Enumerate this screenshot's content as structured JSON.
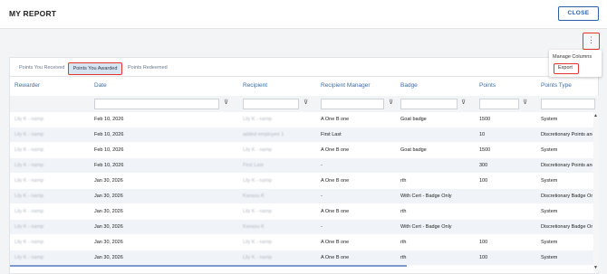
{
  "header": {
    "title": "MY REPORT",
    "close_label": "CLOSE"
  },
  "toolbar": {
    "kebab_glyph": "⋮"
  },
  "menu": {
    "manage_columns": "Manage Columns",
    "export": "Export"
  },
  "tabs": [
    {
      "label": "Points You Received",
      "active": false
    },
    {
      "label": "Points You Awarded",
      "active": true
    },
    {
      "label": "Points Redeemed",
      "active": false
    }
  ],
  "columns": [
    "Rewarder",
    "Date",
    "Recipient",
    "Recipient Manager",
    "Badge",
    "Points",
    "Points Type"
  ],
  "icons": {
    "filter": "filter-icon",
    "scroll_up": "▲",
    "scroll_down": "▼",
    "filter_glyph": "⊽"
  },
  "colors": {
    "accent": "#2e5fa7",
    "highlight": "#e0382c",
    "header_text": "#3e6ca5"
  },
  "rows": [
    {
      "rewarder": "Lily K - namp",
      "date": "Feb 10, 2026",
      "recipient": "Lily K - namp",
      "manager": "A One B one",
      "badge": "Goat badge",
      "points": "1500",
      "type": "System"
    },
    {
      "rewarder": "Lily K - namp",
      "date": "Feb 10, 2026",
      "recipient": "added employee 1",
      "manager": "First Last",
      "badge": "",
      "points": "10",
      "type": "Discretionary Points and B"
    },
    {
      "rewarder": "Lily K - namp",
      "date": "Feb 10, 2026",
      "recipient": "Lily K - namp",
      "manager": "A One B one",
      "badge": "Goat badge",
      "points": "1500",
      "type": "System"
    },
    {
      "rewarder": "Lily K - namp",
      "date": "Feb 10, 2026",
      "recipient": "First Last",
      "manager": "-",
      "badge": "",
      "points": "300",
      "type": "Discretionary Points and B"
    },
    {
      "rewarder": "Lily K - namp",
      "date": "Jan 30, 2026",
      "recipient": "Lily K - namp",
      "manager": "A One B one",
      "badge": "rth",
      "points": "100",
      "type": "System"
    },
    {
      "rewarder": "Lily K - namp",
      "date": "Jan 30, 2026",
      "recipient": "Kanasu K",
      "manager": "-",
      "badge": "With Cert - Badge Only",
      "points": "",
      "type": "Discretionary Badge Only"
    },
    {
      "rewarder": "Lily K - namp",
      "date": "Jan 30, 2026",
      "recipient": "Lily K - namp",
      "manager": "A One B one",
      "badge": "rth",
      "points": "",
      "type": "System"
    },
    {
      "rewarder": "Lily K - namp",
      "date": "Jan 30, 2026",
      "recipient": "Kanasu K",
      "manager": "-",
      "badge": "With Cert - Badge Only",
      "points": "",
      "type": "Discretionary Badge Only"
    },
    {
      "rewarder": "Lily K - namp",
      "date": "Jan 30, 2026",
      "recipient": "Lily K - namp",
      "manager": "A One B one",
      "badge": "rth",
      "points": "100",
      "type": "System"
    },
    {
      "rewarder": "Lily K - namp",
      "date": "Jan 30, 2026",
      "recipient": "Lily K - namp",
      "manager": "A One B one",
      "badge": "rth",
      "points": "100",
      "type": "System"
    }
  ]
}
